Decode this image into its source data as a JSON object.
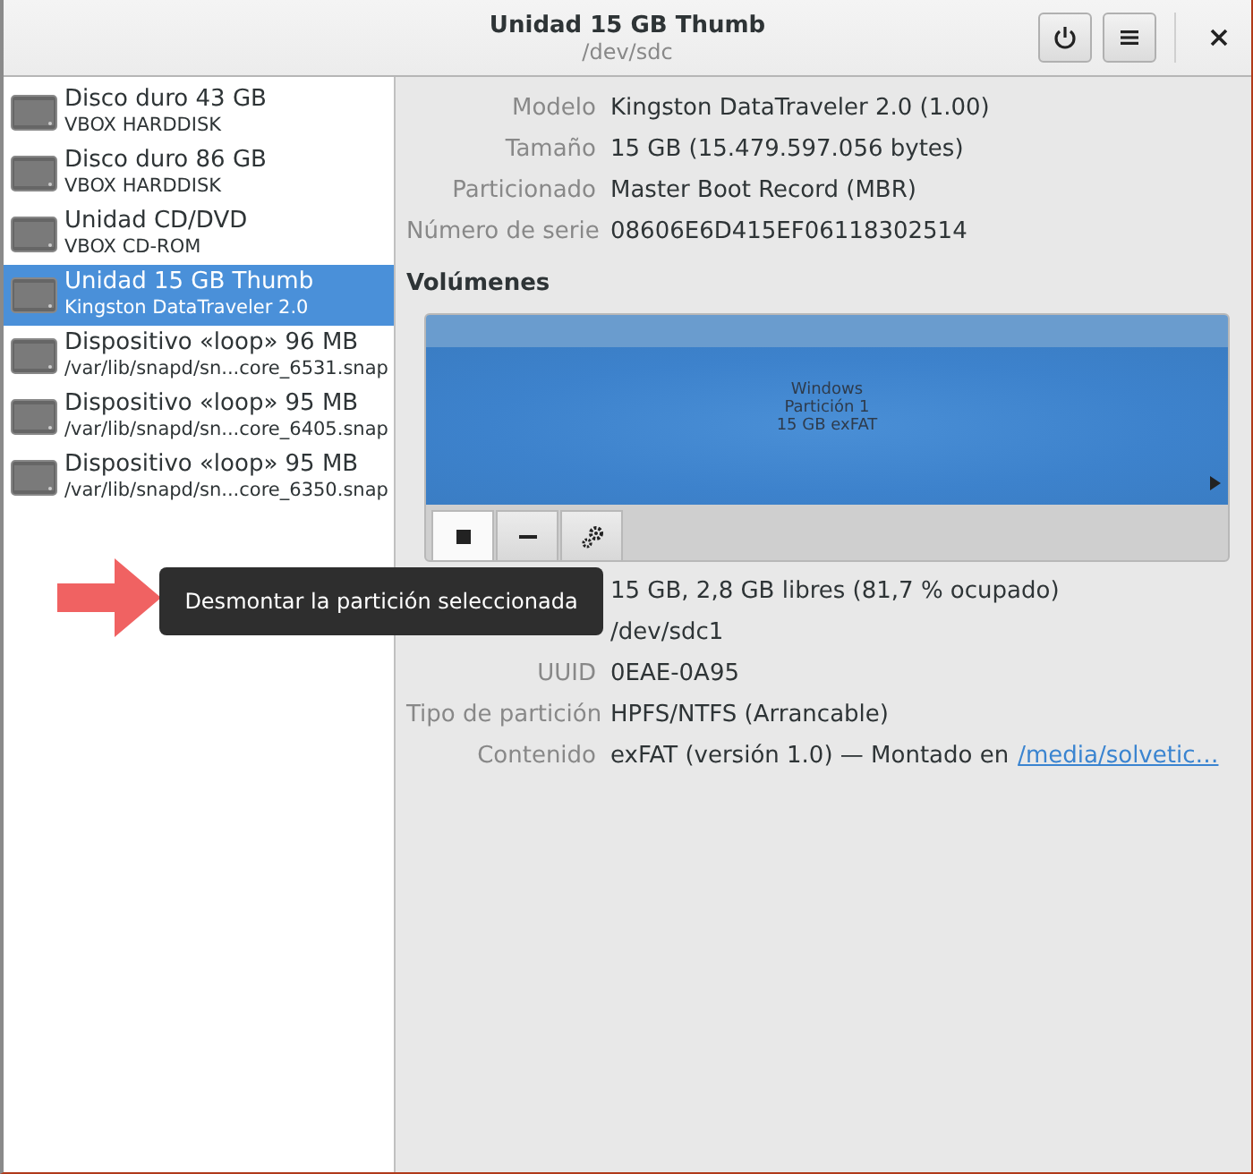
{
  "window": {
    "title": "Unidad 15 GB Thumb",
    "subtitle": "/dev/sdc"
  },
  "header_buttons": [
    {
      "kind": "power"
    },
    {
      "kind": "menu"
    },
    {
      "kind": "close"
    }
  ],
  "sidebar": {
    "items": [
      {
        "name": "Disco duro 43 GB",
        "detail": "VBOX HARDDISK",
        "selected": false
      },
      {
        "name": "Disco duro 86 GB",
        "detail": "VBOX HARDDISK",
        "selected": false
      },
      {
        "name": "Unidad CD/DVD",
        "detail": "VBOX CD-ROM",
        "selected": false
      },
      {
        "name": "Unidad 15 GB Thumb",
        "detail": "Kingston DataTraveler 2.0",
        "selected": true
      },
      {
        "name": "Dispositivo «loop» 96 MB",
        "detail": "/var/lib/snapd/sn...core_6531.snap",
        "selected": false
      },
      {
        "name": "Dispositivo «loop» 95 MB",
        "detail": "/var/lib/snapd/sn...core_6405.snap",
        "selected": false
      },
      {
        "name": "Dispositivo «loop» 95 MB",
        "detail": "/var/lib/snapd/sn...core_6350.snap",
        "selected": false
      }
    ]
  },
  "drive_properties": [
    {
      "label": "Modelo",
      "value": "Kingston DataTraveler 2.0 (1.00)"
    },
    {
      "label": "Tamaño",
      "value": "15 GB (15.479.597.056 bytes)"
    },
    {
      "label": "Particionado",
      "value": "Master Boot Record (MBR)"
    },
    {
      "label": "Número de serie",
      "value": "08606E6D415EF06118302514"
    }
  ],
  "volumes": {
    "heading": "Volúmenes",
    "partitions": [
      {
        "lines": [
          "Windows",
          "Partición 1",
          "15 GB exFAT"
        ],
        "selected": true
      }
    ],
    "toolbar": [
      {
        "kind": "stop",
        "selected": true
      },
      {
        "kind": "remove",
        "selected": false
      },
      {
        "kind": "settings",
        "selected": false
      }
    ]
  },
  "volume_properties": [
    {
      "value": "15 GB, 2,8 GB libres (81,7 % ocupado)"
    },
    {
      "value": "/dev/sdc1"
    },
    {
      "label": "UUID",
      "value": "0EAE-0A95"
    },
    {
      "label": "Tipo de partición",
      "value": "HPFS/NTFS (Arrancable)"
    },
    {
      "label": "Contenido",
      "value": "exFAT (versión 1.0) — Montado en",
      "link": "/media/solvetic…"
    }
  ],
  "tooltip": {
    "text": "Desmontar la partición seleccionada"
  }
}
